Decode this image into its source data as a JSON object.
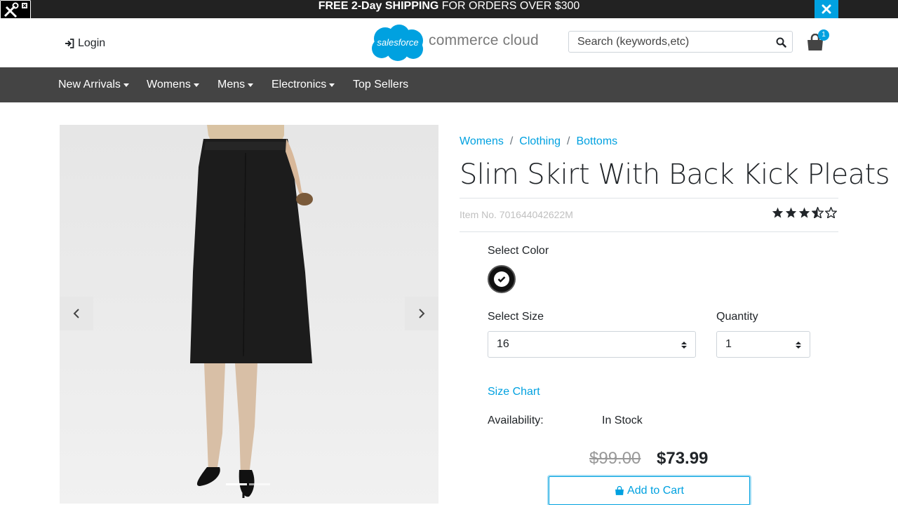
{
  "promo": {
    "part1": "FREE 2-Day",
    "part2": "SHIPPING",
    "part3": "FOR ORDERS OVER $300"
  },
  "header": {
    "login_label": "Login",
    "logo_badge_text": "salesforce",
    "logo_text": "commerce cloud",
    "search_placeholder": "Search (keywords,etc)",
    "cart_count": "1"
  },
  "nav": {
    "items": [
      {
        "label": "New Arrivals"
      },
      {
        "label": "Womens"
      },
      {
        "label": "Mens"
      },
      {
        "label": "Electronics"
      },
      {
        "label": "Top Sellers"
      }
    ]
  },
  "product": {
    "breadcrumb": [
      "Womens",
      "Clothing",
      "Bottoms"
    ],
    "breadcrumb_separator": "/",
    "title": "Slim Skirt With Back Kick Pleats",
    "item_no": "Item No. 701644042622M",
    "rating": 3.5,
    "rating_max": 5,
    "select_color_label": "Select Color",
    "selected_color": "#111111",
    "select_size_label": "Select Size",
    "size_value": "16",
    "quantity_label": "Quantity",
    "quantity_value": "1",
    "size_chart_label": "Size Chart",
    "availability_label": "Availability:",
    "availability_value": "In Stock",
    "price_original": "$99.00",
    "price_sale": "$73.99",
    "add_to_cart_label": "Add to Cart"
  },
  "colors": {
    "accent": "#00a1e0",
    "nav_bg": "#444444",
    "promo_bg": "#222222"
  }
}
